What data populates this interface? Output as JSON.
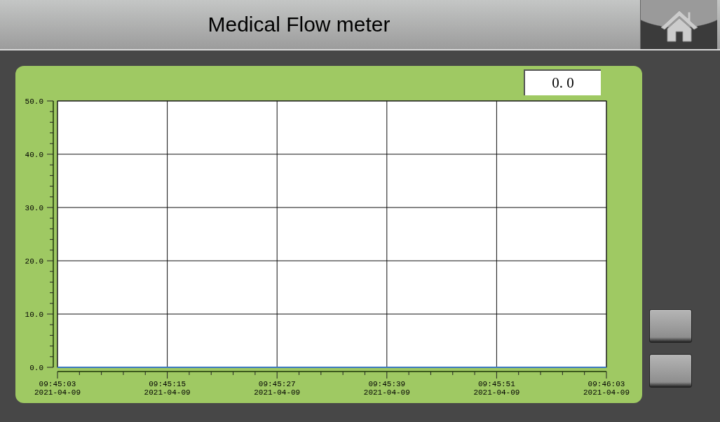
{
  "header": {
    "title": "Medical Flow meter"
  },
  "readout": {
    "value": "0. 0"
  },
  "chart_data": {
    "type": "line",
    "ylim": [
      0,
      50
    ],
    "grid": true,
    "yticks": [
      {
        "value": 0,
        "label": "0.0"
      },
      {
        "value": 10,
        "label": "10.0"
      },
      {
        "value": 20,
        "label": "20.0"
      },
      {
        "value": 30,
        "label": "30.0"
      },
      {
        "value": 40,
        "label": "40.0"
      },
      {
        "value": 50,
        "label": "50.0"
      }
    ],
    "categories": [
      "09:45:03\n2021-04-09",
      "09:45:15\n2021-04-09",
      "09:45:27\n2021-04-09",
      "09:45:39\n2021-04-09",
      "09:45:51\n2021-04-09",
      "09:46:03\n2021-04-09"
    ],
    "series": [
      {
        "color": "#3a78c0",
        "values": [
          0,
          0,
          0,
          0,
          0,
          0
        ]
      }
    ]
  },
  "side_buttons": [
    {
      "kind": "blank"
    },
    {
      "kind": "blank"
    }
  ]
}
